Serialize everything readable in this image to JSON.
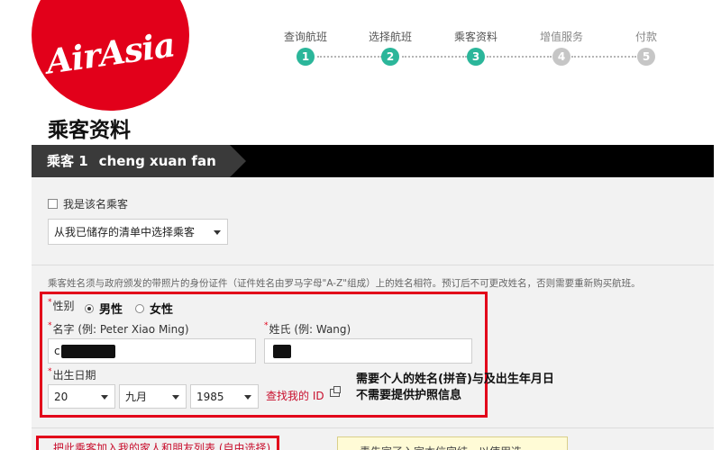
{
  "brand": {
    "logo_text": "AirAsia",
    "color": "#e2001a"
  },
  "steps": [
    {
      "num": "1",
      "label": "查询航班",
      "state": "done"
    },
    {
      "num": "2",
      "label": "选择航班",
      "state": "done"
    },
    {
      "num": "3",
      "label": "乘客资料",
      "state": "current"
    },
    {
      "num": "4",
      "label": "增值服务",
      "state": "upcoming"
    },
    {
      "num": "5",
      "label": "付款",
      "state": "upcoming"
    }
  ],
  "page_title": "乘客资料",
  "passenger": {
    "index_label": "乘客 1",
    "name": "cheng xuan fan"
  },
  "self_checkbox": {
    "label": "我是该名乘客",
    "checked": false
  },
  "saved_select": {
    "value": "从我已储存的清单中选择乘客"
  },
  "notice": "乘客姓名须与政府颁发的带照片的身份证件（证件姓名由罗马字母\"A-Z\"组成）上的姓名相符。预订后不可更改姓名，否则需要重新购买航班。",
  "gender": {
    "label": "性别",
    "male": "男性",
    "female": "女性",
    "selected": "male"
  },
  "first_name": {
    "label": "名字 (例: Peter Xiao Ming)",
    "value_prefix": "c"
  },
  "last_name": {
    "label": "姓氏 (例: Wang)",
    "value_prefix": ""
  },
  "dob": {
    "label": "出生日期",
    "day": "20",
    "month": "九月",
    "year": "1985"
  },
  "find_id_link": "查找我的 ID",
  "annotation": {
    "line1": "需要个人的姓名(拼音)与及出生年月日",
    "line2": "不需要提供护照信息"
  },
  "bottom": {
    "add_link": "把此乘客加入我的家人和朋友列表 (自由选择)",
    "tip": "青先宣了入宣本信完结，以使用选"
  }
}
